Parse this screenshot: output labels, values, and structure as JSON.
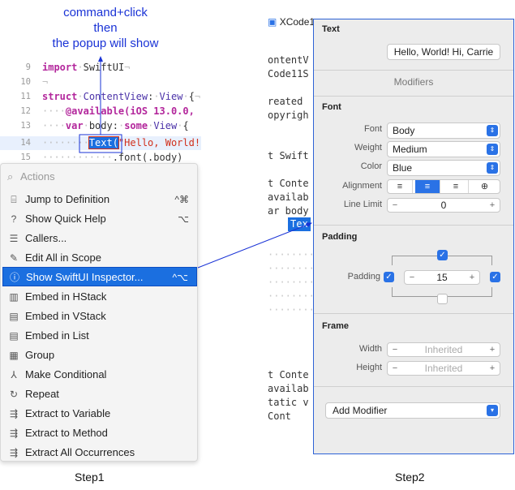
{
  "annotation": {
    "line1": "command+click",
    "line2": "then",
    "line3": "the popup will show"
  },
  "editor": {
    "lines": [
      {
        "num": "9",
        "kw": "import",
        "rest": "SwiftUI"
      },
      {
        "num": "10"
      },
      {
        "num": "11",
        "kw": "struct",
        "type": "ContentView",
        "colon": ":",
        "proto": "View",
        "brace": "{"
      },
      {
        "num": "12",
        "attr": "@available(iOS 13.0.0,"
      },
      {
        "num": "13",
        "kw": "var",
        "name": "body",
        "some": "some",
        "proto": "View",
        "brace": "{"
      },
      {
        "num": "14",
        "call": "Text(",
        "str": "\"Hello, World!"
      },
      {
        "num": "15",
        "rest": ".font(.body)"
      }
    ]
  },
  "actions": {
    "search_placeholder": "Actions",
    "items": [
      {
        "icon": "⌸",
        "label": "Jump to Definition",
        "shortcut": "^⌘"
      },
      {
        "icon": "?",
        "label": "Show Quick Help",
        "shortcut": "⌥"
      },
      {
        "icon": "☰",
        "label": "Callers...",
        "shortcut": ""
      },
      {
        "icon": "✎",
        "label": "Edit All in Scope",
        "shortcut": ""
      },
      {
        "icon": "ⓘ",
        "label": "Show SwiftUI Inspector...",
        "shortcut": "^⌥"
      },
      {
        "icon": "▥",
        "label": "Embed in HStack",
        "shortcut": ""
      },
      {
        "icon": "▤",
        "label": "Embed in VStack",
        "shortcut": ""
      },
      {
        "icon": "▤",
        "label": "Embed in List",
        "shortcut": ""
      },
      {
        "icon": "▦",
        "label": "Group",
        "shortcut": ""
      },
      {
        "icon": "⅄",
        "label": "Make Conditional",
        "shortcut": ""
      },
      {
        "icon": "↻",
        "label": "Repeat",
        "shortcut": ""
      },
      {
        "icon": "⇶",
        "label": "Extract to Variable",
        "shortcut": ""
      },
      {
        "icon": "⇶",
        "label": "Extract to Method",
        "shortcut": ""
      },
      {
        "icon": "⇶",
        "label": "Extract All Occurrences",
        "shortcut": ""
      }
    ]
  },
  "step1": "Step1",
  "step2": "Step2",
  "editor2": {
    "tab": "XCode1",
    "lines": [
      "ontentV",
      "Code11S",
      "",
      "reated",
      "opyrigh",
      "",
      "",
      "t Swift",
      "",
      "t Conte",
      "availab",
      "ar body",
      "",
      "",
      "",
      "",
      "",
      "",
      "",
      "",
      "",
      "",
      "",
      "",
      "",
      "",
      "t Conte",
      "availab",
      "tatic v",
      "Cont"
    ]
  },
  "tex_badge": "Tex",
  "inspector": {
    "text_section": "Text",
    "text_value": "Hello, World! Hi, Carrie",
    "modifiers_label": "Modifiers",
    "font_section": "Font",
    "font_label": "Font",
    "font_value": "Body",
    "weight_label": "Weight",
    "weight_value": "Medium",
    "color_label": "Color",
    "color_value": "Blue",
    "alignment_label": "Alignment",
    "line_limit_label": "Line Limit",
    "line_limit_value": "0",
    "padding_section": "Padding",
    "padding_label": "Padding",
    "padding_value": "15",
    "frame_section": "Frame",
    "width_label": "Width",
    "width_value": "Inherited",
    "height_label": "Height",
    "height_value": "Inherited",
    "add_modifier": "Add Modifier",
    "minus": "−",
    "plus": "+"
  }
}
